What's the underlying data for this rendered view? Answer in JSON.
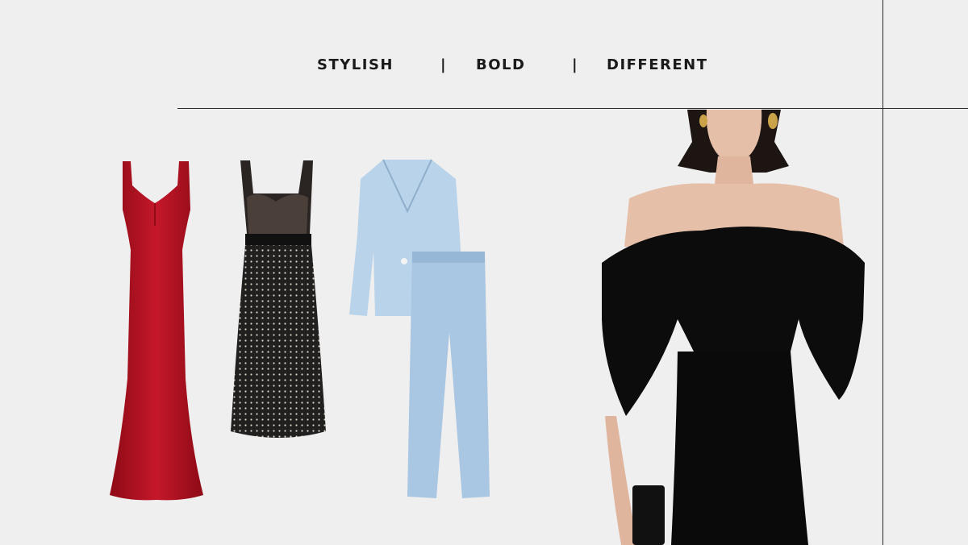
{
  "tagline": {
    "word1": "STYLISH",
    "sep1": "|",
    "word2": "BOLD",
    "sep2": "|",
    "word3": "DIFFERENT"
  },
  "colors": {
    "background": "#efefef",
    "rule": "#2a2a2a",
    "red_gown": "#b3101f",
    "black_dress": "#1b1917",
    "blue_suit": "#b9d3ea",
    "model_dress": "#0c0c0c",
    "skin": "#e6bfa9"
  },
  "items": [
    {
      "icon": "red-gown-icon"
    },
    {
      "icon": "embellished-tulle-dress-icon"
    },
    {
      "icon": "blue-suit-icon"
    },
    {
      "icon": "model-off-shoulder-dress-icon"
    }
  ]
}
